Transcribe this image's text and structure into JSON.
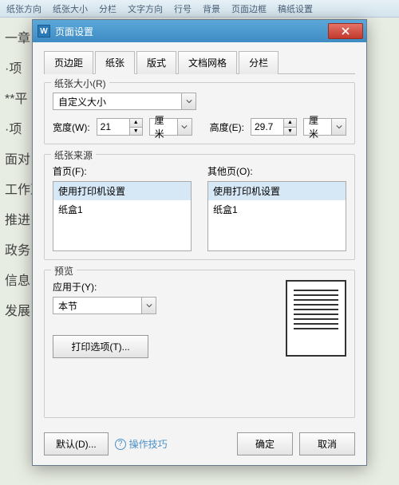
{
  "ribbon": [
    "纸张方向",
    "纸张大小",
    "分栏",
    "文字方向",
    "行号",
    "背景",
    "页面边框",
    "稿纸设置"
  ],
  "background_lines": [
    "",
    "",
    "",
    "",
    "一章",
    "",
    "·项",
    "",
    "**平",
    "·项",
    "",
    "",
    "面对",
    "工作正",
    "推进",
    "政务",
    "信息",
    "发展"
  ],
  "dialog": {
    "title": "页面设置",
    "tabs": [
      "页边距",
      "纸张",
      "版式",
      "文档网格",
      "分栏"
    ],
    "active_tab": 1,
    "paper_size": {
      "legend": "纸张大小(R)",
      "selection": "自定义大小",
      "width_label": "宽度(W):",
      "width_value": "21",
      "width_unit": "厘米",
      "height_label": "高度(E):",
      "height_value": "29.7",
      "height_unit": "厘米"
    },
    "paper_source": {
      "legend": "纸张来源",
      "first_label": "首页(F):",
      "other_label": "其他页(O):",
      "items": [
        "使用打印机设置",
        "纸盒1"
      ]
    },
    "preview": {
      "legend": "预览",
      "apply_label": "应用于(Y):",
      "apply_value": "本节",
      "print_options": "打印选项(T)..."
    },
    "footer": {
      "default": "默认(D)...",
      "tip": "操作技巧",
      "ok": "确定",
      "cancel": "取消"
    }
  }
}
